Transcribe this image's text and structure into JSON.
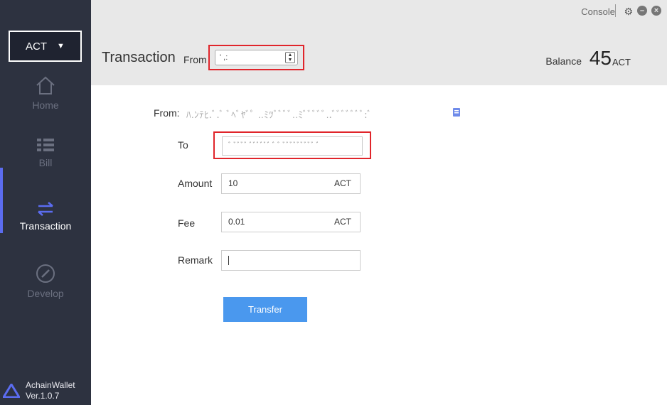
{
  "sidebar": {
    "coin": {
      "label": "ACT",
      "arrow": "▼"
    },
    "items": [
      {
        "label": "Home",
        "icon": "home-icon",
        "active": false
      },
      {
        "label": "Bill",
        "icon": "list-icon",
        "active": false
      },
      {
        "label": "Transaction",
        "icon": "transfer-arrows-icon",
        "active": true
      },
      {
        "label": "Develop",
        "icon": "gauge-icon",
        "active": false
      }
    ],
    "brand": {
      "name": "AchainWallet",
      "version": "Ver.1.0.7"
    }
  },
  "window": {
    "console_label": "Console",
    "icons": [
      "gear-icon",
      "minimize-icon",
      "close-icon"
    ]
  },
  "header": {
    "title": "Transaction",
    "from_label": "From",
    "from_select_value": "' ,:",
    "balance_label": "Balance",
    "balance_value": "45",
    "balance_unit": "ACT"
  },
  "form": {
    "from_label": "From:",
    "from_address": "ﾊ.ﾝﾃﾋ.ﾞ.ﾞ ﾞﾍﾞﾔﾞﾟ ..ﾐﾂﾞﾞﾞﾞ..ﾐﾞﾞﾞﾞﾞ..ﾞﾞﾞﾞﾞﾞﾞ:ﾞ",
    "to_label": "To",
    "to_value": "ﾞ ﾞﾞﾞﾞ ﾞﾞﾞﾞﾞﾞ ﾞ ﾞ ﾞﾞﾞﾞﾞﾞﾞﾞﾞ ﾞ",
    "amount_label": "Amount",
    "amount_value": "10",
    "amount_unit": "ACT",
    "fee_label": "Fee",
    "fee_value": "0.01",
    "fee_unit": "ACT",
    "remark_label": "Remark",
    "remark_value": "",
    "transfer_button": "Transfer"
  },
  "colors": {
    "sidebar_bg": "#2d3240",
    "accent": "#5b6cf0",
    "button": "#4a98ee",
    "highlight": "#e0252b"
  }
}
